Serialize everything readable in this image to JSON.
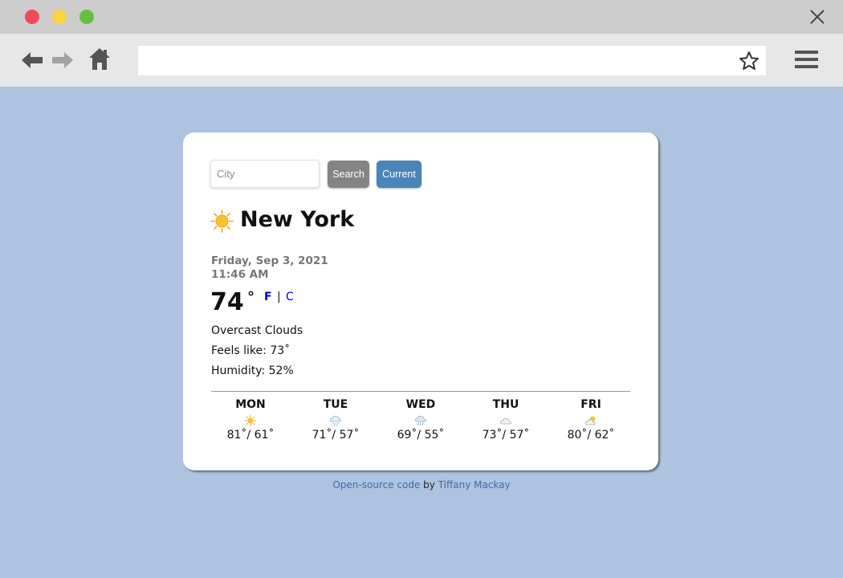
{
  "browser": {
    "url": ""
  },
  "search": {
    "placeholder": "City",
    "search_label": "Search",
    "current_label": "Current"
  },
  "weather": {
    "city": "New York",
    "icon": "sun-icon",
    "date": "Friday, Sep 3, 2021",
    "time": "11:46 AM",
    "temperature": "74",
    "degree_symbol": "°",
    "unit_f": "F",
    "unit_separator": "|",
    "unit_c": "C",
    "active_unit": "F",
    "description": "Overcast Clouds",
    "feels_like": "Feels like: 73˚",
    "humidity": "Humidity: 52%"
  },
  "forecast": [
    {
      "day": "MON",
      "icon": "sun-icon",
      "temps": "81˚/ 61˚"
    },
    {
      "day": "TUE",
      "icon": "snow-cloud-icon",
      "temps": "71˚/ 57˚"
    },
    {
      "day": "WED",
      "icon": "rain-cloud-icon",
      "temps": "69˚/ 55˚"
    },
    {
      "day": "THU",
      "icon": "cloud-icon",
      "temps": "73˚/ 57˚"
    },
    {
      "day": "FRI",
      "icon": "partly-cloudy-icon",
      "temps": "80˚/ 62˚"
    }
  ],
  "footer": {
    "link_text": "Open-source code",
    "by_text": " by ",
    "author": "Tiffany Mackay"
  },
  "colors": {
    "page_background": "#aec3df",
    "search_button": "#848484",
    "current_button": "#4a84b8",
    "unit_link": "#0000cc",
    "footer_link": "#3a6ea5"
  }
}
